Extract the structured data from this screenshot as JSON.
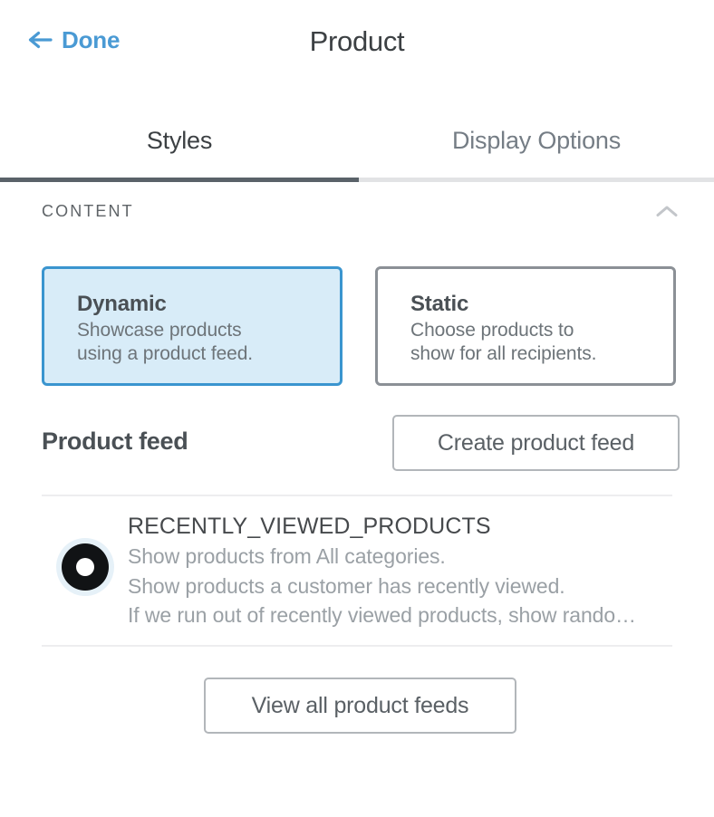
{
  "header": {
    "back_label": "Done",
    "back_icon": "arrow-left-icon",
    "title": "Product"
  },
  "tabs": [
    {
      "label": "Styles",
      "active": true
    },
    {
      "label": "Display Options",
      "active": false
    }
  ],
  "section": {
    "title": "CONTENT",
    "collapse_icon": "chevron-up-icon"
  },
  "content_options": [
    {
      "title": "Dynamic",
      "desc_line1": "Showcase products",
      "desc_line2": "using a product feed.",
      "selected": true
    },
    {
      "title": "Static",
      "desc_line1": "Choose products to",
      "desc_line2": "show for all recipients.",
      "selected": false
    }
  ],
  "product_feed": {
    "label": "Product feed",
    "create_button": "Create product feed"
  },
  "feed_item": {
    "icon": "product-feed-ring-icon",
    "name": "RECENTLY_VIEWED_PRODUCTS",
    "line1": "Show products from All categories.",
    "line2": "Show products a customer has recently viewed.",
    "line3": "If we run out of recently viewed products, show rando…"
  },
  "footer": {
    "view_all_button": "View all product feeds"
  },
  "colors": {
    "link_blue": "#4a9ad4",
    "selected_card_bg": "#d8ecf8",
    "selected_card_border": "#3a95cf",
    "active_tab_underline": "#5a6269",
    "tab_track": "#e2e3e5",
    "button_border": "#b2b6ba",
    "divider": "#ededef",
    "muted_text": "#9aa0a5",
    "heading_text": "#4a5055"
  }
}
